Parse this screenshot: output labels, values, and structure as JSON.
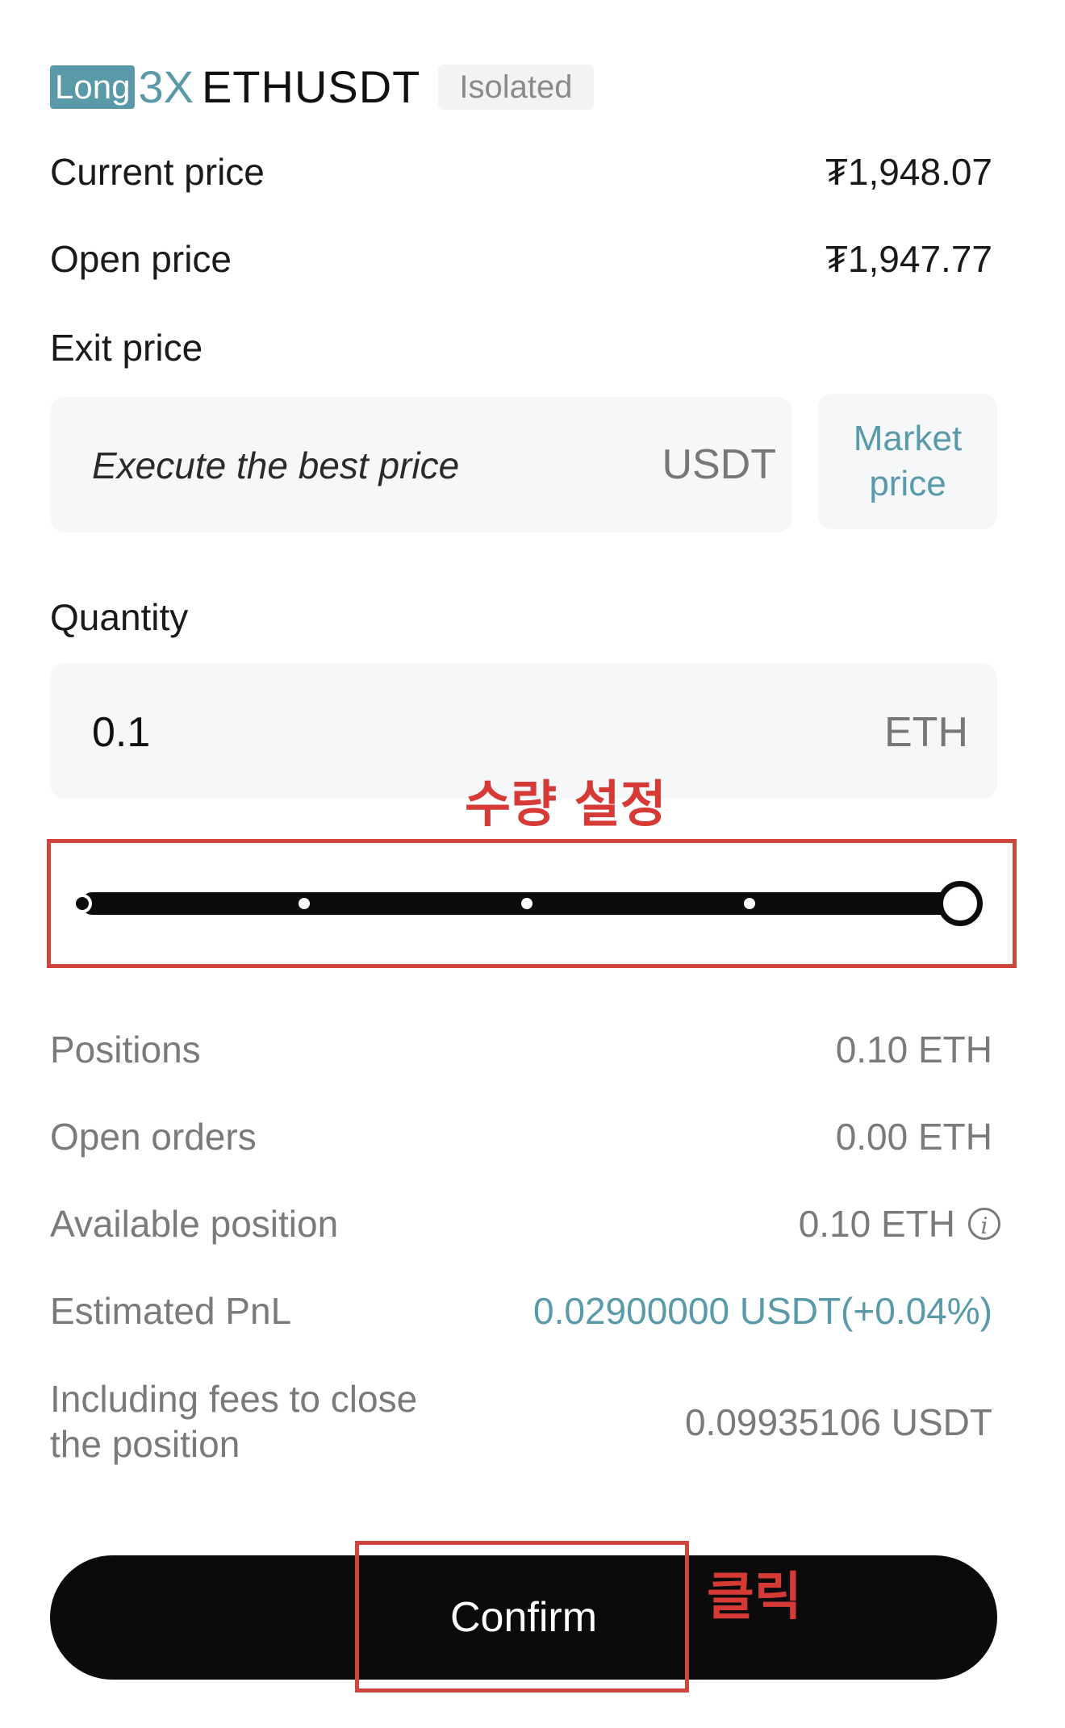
{
  "header": {
    "side": "Long",
    "leverage": "3X",
    "symbol": "ETHUSDT",
    "margin_mode": "Isolated"
  },
  "prices": {
    "current_label": "Current price",
    "current_value": "₮1,948.07",
    "open_label": "Open price",
    "open_value": "₮1,947.77",
    "exit_label": "Exit price"
  },
  "exit_input": {
    "placeholder": "Execute the best price",
    "unit": "USDT",
    "market_button": "Market price"
  },
  "quantity": {
    "label": "Quantity",
    "value": "0.1",
    "unit": "ETH",
    "slider_percent": 100
  },
  "annotations": {
    "quantity_note": "수량 설정",
    "click_note": "클릭"
  },
  "stats": [
    {
      "label": "Positions",
      "value": "0.10 ETH"
    },
    {
      "label": "Open orders",
      "value": "0.00 ETH"
    },
    {
      "label": "Available position",
      "value": "0.10 ETH"
    },
    {
      "label": "Estimated PnL",
      "value": "0.02900000 USDT(+0.04%)"
    },
    {
      "label": "Including fees to close the position",
      "value": "0.09935106 USDT"
    }
  ],
  "confirm_label": "Confirm",
  "colors": {
    "accent": "#5a9aa8",
    "annotation": "#d63a36",
    "button": "#0b0b0b"
  },
  "icons": {
    "info": "info-circle-icon"
  }
}
